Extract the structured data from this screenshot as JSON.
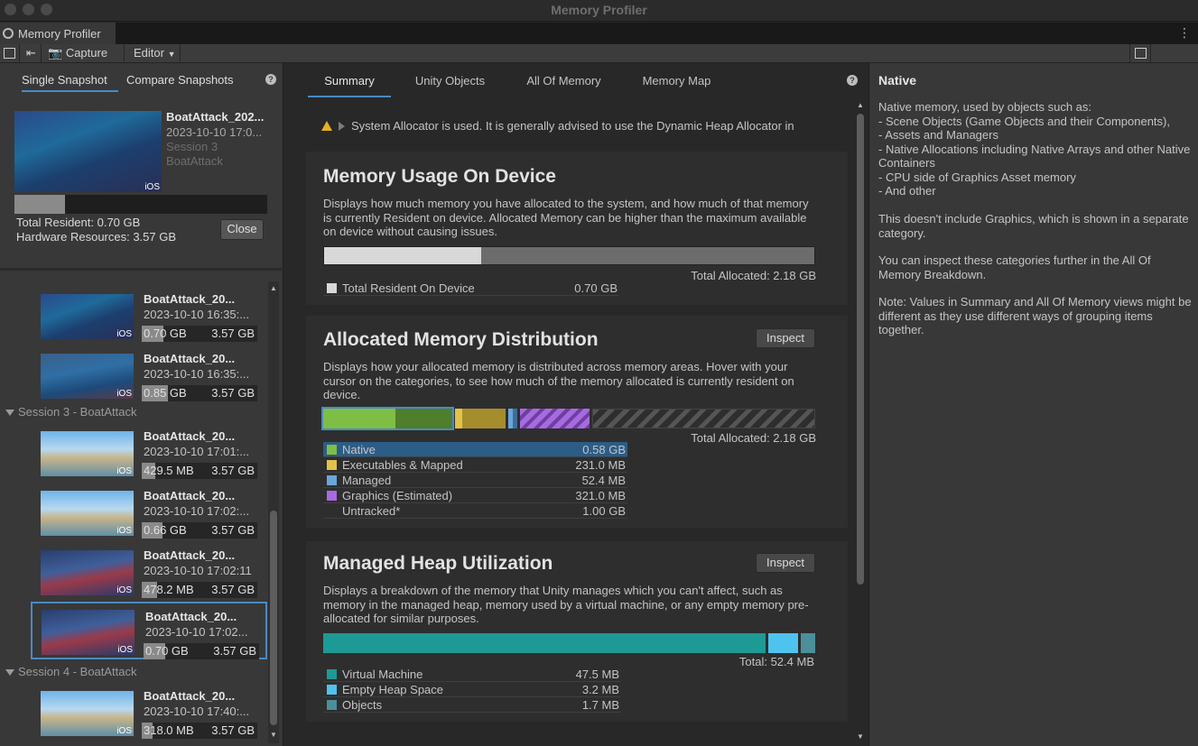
{
  "window": {
    "title": "Memory Profiler",
    "tab_label": "Memory Profiler"
  },
  "toolbar": {
    "capture_label": "Capture",
    "editor_label": "Editor"
  },
  "left": {
    "tabs": [
      "Single Snapshot",
      "Compare Snapshots"
    ],
    "current": {
      "name": "BoatAttack_202...",
      "date": "2023-10-10 17:0...",
      "session": "Session 3",
      "project": "BoatAttack",
      "ios": "iOS",
      "resident_fraction": 0.2,
      "total_resident": "Total Resident: 0.70 GB",
      "hardware": "Hardware Resources: 3.57 GB",
      "close_label": "Close"
    },
    "items": [
      {
        "name": "BoatAttack_20...",
        "date": "2023-10-10 16:35:...",
        "val": "0.70 GB",
        "max": "3.57 GB",
        "ios": "iOS",
        "fill": 0.19
      },
      {
        "name": "BoatAttack_20...",
        "date": "2023-10-10 16:35:...",
        "val": "0.85 GB",
        "max": "3.57 GB",
        "ios": "iOS",
        "fill": 0.23
      },
      {
        "name": "BoatAttack_20...",
        "date": "2023-10-10 17:01:...",
        "val": "429.5 MB",
        "max": "3.57 GB",
        "ios": "iOS",
        "fill": 0.12
      },
      {
        "name": "BoatAttack_20...",
        "date": "2023-10-10 17:02:...",
        "val": "0.66 GB",
        "max": "3.57 GB",
        "ios": "iOS",
        "fill": 0.18
      },
      {
        "name": "BoatAttack_20...",
        "date": "2023-10-10 17:02:11",
        "val": "478.2 MB",
        "max": "3.57 GB",
        "ios": "iOS",
        "fill": 0.13
      },
      {
        "name": "BoatAttack_20...",
        "date": "2023-10-10 17:02...",
        "val": "0.70 GB",
        "max": "3.57 GB",
        "ios": "iOS",
        "fill": 0.19
      },
      {
        "name": "BoatAttack_20...",
        "date": "2023-10-10 17:40:...",
        "val": "318.0 MB",
        "max": "3.57 GB",
        "ios": "iOS",
        "fill": 0.09
      }
    ],
    "sessions": [
      "Session 3 - BoatAttack",
      "Session 4 - BoatAttack"
    ]
  },
  "main": {
    "tabs": [
      "Summary",
      "Unity Objects",
      "All Of Memory",
      "Memory Map"
    ],
    "warning": "System Allocator is used. It is generally advised to use the Dynamic Heap Allocator in",
    "usage": {
      "title": "Memory Usage On Device",
      "desc": "Displays how much memory you have allocated to the system, and how much of that memory is currently Resident on device. Allocated Memory can be higher than the maximum available on device without causing issues.",
      "total": "Total Allocated: 2.18 GB",
      "resident_fraction": 0.32,
      "legend": [
        {
          "name": "Total Resident On Device",
          "value": "0.70 GB",
          "color": "#d8d8d8"
        }
      ]
    },
    "distribution": {
      "title": "Allocated Memory Distribution",
      "inspect": "Inspect",
      "desc": "Displays how your allocated memory is distributed across memory areas. Hover with your cursor on the categories, to see how much of the memory allocated is currently resident on device.",
      "total": "Total Allocated: 2.18 GB",
      "legend": [
        {
          "name": "Native",
          "value": "0.58 GB",
          "color": "#7fbe45"
        },
        {
          "name": "Executables & Mapped",
          "value": "231.0 MB",
          "color": "#e2c24a"
        },
        {
          "name": "Managed",
          "value": "52.4 MB",
          "color": "#6aa6d8"
        },
        {
          "name": "Graphics (Estimated)",
          "value": "321.0 MB",
          "color": "#a86ae0"
        },
        {
          "name": "Untracked*",
          "value": "1.00 GB",
          "color": "#2e2e2e"
        }
      ]
    },
    "heap": {
      "title": "Managed Heap Utilization",
      "inspect": "Inspect",
      "desc": "Displays a breakdown of the memory that Unity manages which you can't affect, such as memory in the managed heap, memory used by a virtual machine, or any empty memory pre-allocated for similar purposes.",
      "total": "Total: 52.4 MB",
      "legend": [
        {
          "name": "Virtual Machine",
          "value": "47.5 MB",
          "color": "#1e9a94"
        },
        {
          "name": "Empty Heap Space",
          "value": "3.2 MB",
          "color": "#4ec3ef"
        },
        {
          "name": "Objects",
          "value": "1.7 MB",
          "color": "#4a8f9a"
        }
      ]
    }
  },
  "details": {
    "title": "Native",
    "p1": "Native memory, used by objects such as:\n- Scene Objects (Game Objects and their Components),\n- Assets and Managers\n- Native Allocations including Native Arrays and other Native Containers\n- CPU side of Graphics Asset memory\n- And other",
    "p2": "This doesn't include Graphics, which is shown in a separate category.",
    "p3": "You can inspect these categories further in the All Of Memory Breakdown.",
    "p4": "Note: Values in Summary and All Of Memory views might be different as they use different ways of grouping items together."
  }
}
